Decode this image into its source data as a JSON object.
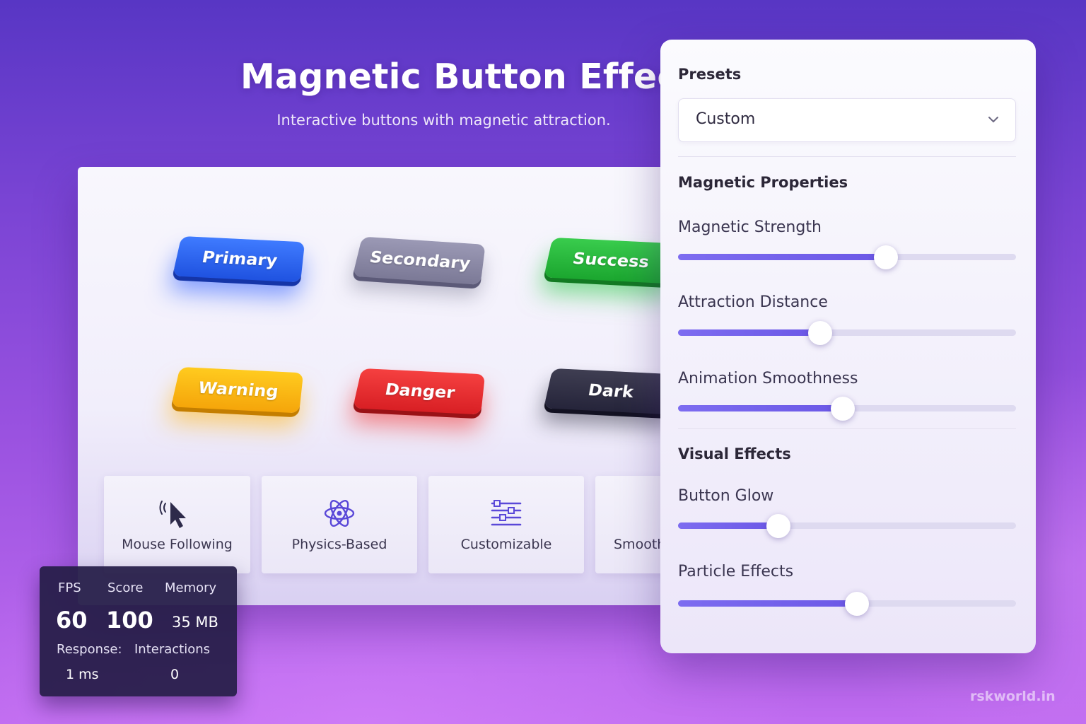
{
  "hero": {
    "title": "Magnetic Button Effect",
    "subtitle": "Interactive buttons with magnetic attraction."
  },
  "demo": {
    "buttons": [
      {
        "label": "Primary",
        "color": "#2a62f5"
      },
      {
        "label": "Secondary",
        "color": "#8a88a6"
      },
      {
        "label": "Success",
        "color": "#24b53a"
      },
      {
        "label": "Warning",
        "color": "#f8b612"
      },
      {
        "label": "Danger",
        "color": "#e6282c"
      },
      {
        "label": "Dark",
        "color": "#302f45"
      }
    ],
    "features": [
      {
        "label": "Mouse Following",
        "icon": "cursor-icon"
      },
      {
        "label": "Physics-Based",
        "icon": "atom-icon"
      },
      {
        "label": "Customizable",
        "icon": "sliders-icon"
      },
      {
        "label": "Smooth",
        "icon": "smooth-icon"
      }
    ]
  },
  "stats": {
    "fps_label": "FPS",
    "fps_value": "60",
    "score_label": "Score",
    "score_value": "100",
    "memory_label": "Memory",
    "memory_value": "35 MB",
    "response_label": "Response:",
    "response_value": "1 ms",
    "interactions_label": "Interactions",
    "interactions_value": "0"
  },
  "panel": {
    "presets_heading": "Presets",
    "preset_selected": "Custom",
    "magnetic_heading": "Magnetic Properties",
    "visual_heading": "Visual Effects",
    "sliders": [
      {
        "label": "Magnetic Strength",
        "value": 0.615
      },
      {
        "label": "Attraction Distance",
        "value": 0.42
      },
      {
        "label": "Animation Smoothness",
        "value": 0.487
      },
      {
        "label": "Button Glow",
        "value": 0.298
      },
      {
        "label": "Particle Effects",
        "value": 0.53
      }
    ]
  },
  "watermark": "rskworld.in",
  "colors": {
    "accent": "#6b58e6",
    "background_top": "#5836c4",
    "background_bottom": "#c06cf0"
  }
}
